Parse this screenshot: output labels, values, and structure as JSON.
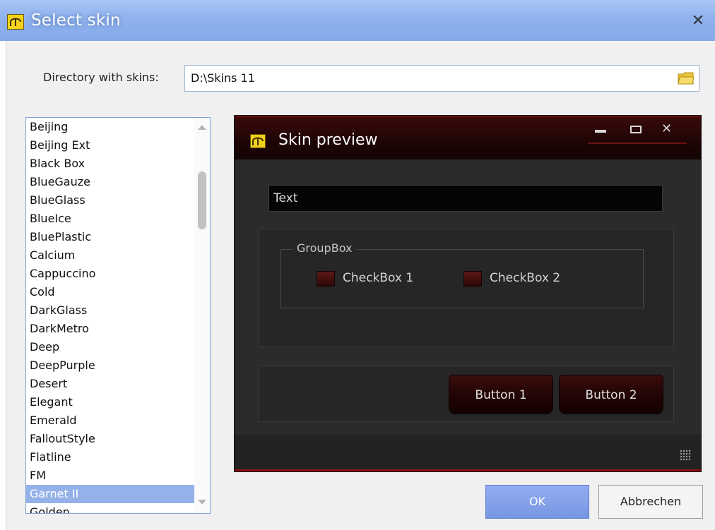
{
  "window": {
    "title": "Select skin",
    "close_glyph": "✕"
  },
  "directory": {
    "label": "Directory with skins:",
    "value": "D:\\Skins 11"
  },
  "skins": [
    "Beijing",
    "Beijing Ext",
    "Black Box",
    "BlueGauze",
    "BlueGlass",
    "BlueIce",
    "BluePlastic",
    "Calcium",
    "Cappuccino",
    "Cold",
    "DarkGlass",
    "DarkMetro",
    "Deep",
    "DeepPurple",
    "Desert",
    "Elegant",
    "Emerald",
    "FalloutStyle",
    "Flatline",
    "FM",
    "Garnet II",
    "Golden"
  ],
  "selected_skin": "Garnet II",
  "preview": {
    "title": "Skin preview",
    "textbox": "Text",
    "groupbox_label": "GroupBox",
    "checkbox1": "CheckBox 1",
    "checkbox2": "CheckBox 2",
    "button1": "Button 1",
    "button2": "Button 2"
  },
  "buttons": {
    "ok": "OK",
    "cancel": "Abbrechen"
  },
  "colors": {
    "titlebar": "#8fb2ee",
    "selection": "#94b1ea",
    "preview_accent": "#8b1111"
  }
}
